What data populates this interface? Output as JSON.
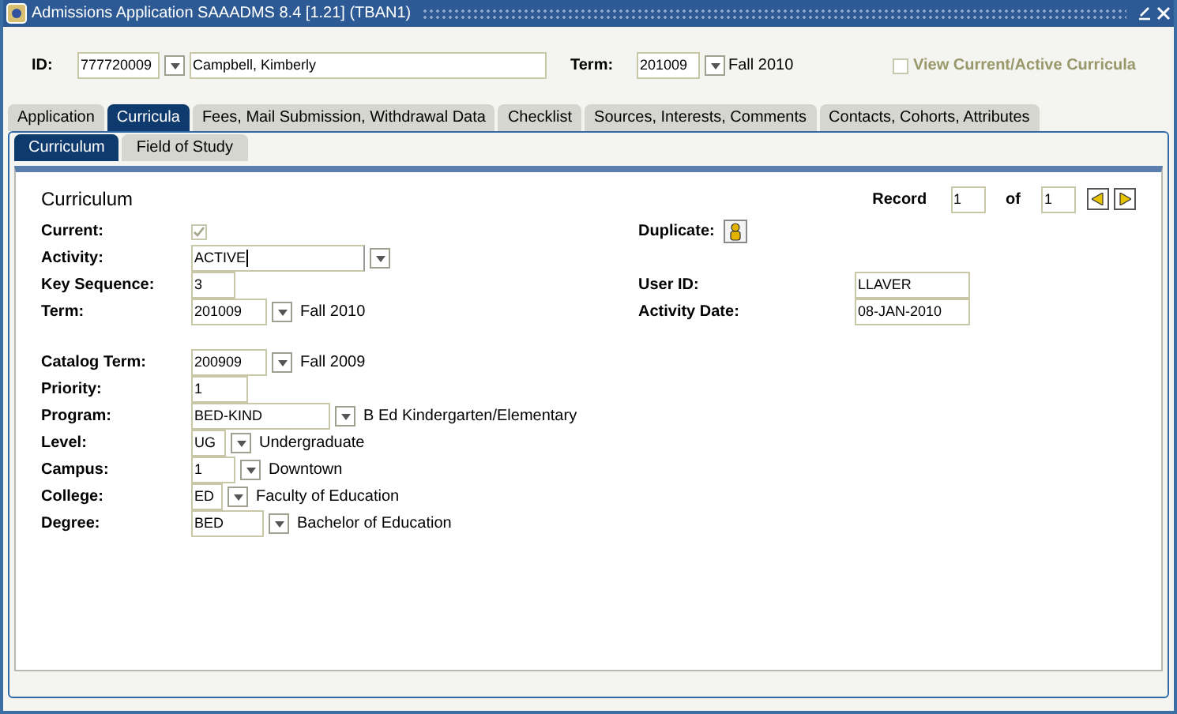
{
  "window": {
    "title": "Admissions Application  SAAADMS  8.4  [1.21]  (TBAN1)"
  },
  "header": {
    "id_label": "ID:",
    "id_value": "777720009",
    "id_dropdown": true,
    "name_value": "Campbell, Kimberly",
    "term_label": "Term:",
    "term_value": "201009",
    "term_dropdown": true,
    "term_description": "Fall 2010",
    "view_current": {
      "label": "View Current/Active Curricula",
      "checked": false,
      "disabled": true
    }
  },
  "tabs": [
    {
      "label": "Application",
      "selected": false
    },
    {
      "label": "Curricula",
      "selected": true
    },
    {
      "label": "Fees, Mail Submission, Withdrawal Data",
      "selected": false
    },
    {
      "label": "Checklist",
      "selected": false
    },
    {
      "label": "Sources, Interests, Comments",
      "selected": false
    },
    {
      "label": "Contacts, Cohorts, Attributes",
      "selected": false
    }
  ],
  "subtabs": [
    {
      "label": "Curriculum",
      "selected": true
    },
    {
      "label": "Field of Study",
      "selected": false
    }
  ],
  "form": {
    "title": "Curriculum",
    "record": {
      "label": "Record",
      "value": "1",
      "of_label": "of",
      "total": "1"
    },
    "rows": [
      {
        "kind": "checkbox",
        "label": "Current:",
        "checked": true,
        "disabled": true,
        "right": {
          "kind": "button",
          "label": "Duplicate:"
        }
      },
      {
        "kind": "field",
        "label": "Activity:",
        "value": "ACTIVE",
        "dropdown": true,
        "focused": true
      },
      {
        "kind": "field",
        "label": "Key Sequence:",
        "value": "3",
        "right": {
          "kind": "field",
          "label": "User ID:",
          "value": "LLAVER"
        }
      },
      {
        "kind": "field",
        "label": "Term:",
        "value": "201009",
        "dropdown": true,
        "description": "Fall 2010",
        "right": {
          "kind": "field",
          "label": "Activity Date:",
          "value": "08-JAN-2010"
        }
      },
      {
        "kind": "field",
        "label": "Catalog Term:",
        "value": "200909",
        "dropdown": true,
        "description": "Fall 2009",
        "gap_before": true
      },
      {
        "kind": "field",
        "label": "Priority:",
        "value": "1"
      },
      {
        "kind": "field",
        "label": "Program:",
        "value": "BED-KIND",
        "dropdown": true,
        "description": "B Ed Kindergarten/Elementary"
      },
      {
        "kind": "field",
        "label": "Level:",
        "value": "UG",
        "dropdown": true,
        "description": "Undergraduate"
      },
      {
        "kind": "field",
        "label": "Campus:",
        "value": "1",
        "dropdown": true,
        "description": "Downtown"
      },
      {
        "kind": "field",
        "label": "College:",
        "value": "ED",
        "dropdown": true,
        "description": "Faculty of Education"
      },
      {
        "kind": "field",
        "label": "Degree:",
        "value": "BED",
        "dropdown": true,
        "description": "Bachelor of Education"
      }
    ]
  }
}
